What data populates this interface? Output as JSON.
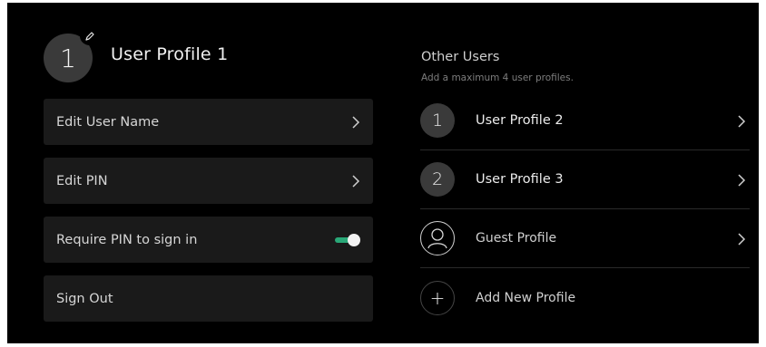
{
  "current_profile": {
    "avatar_number": "1",
    "name": "User Profile 1",
    "edit_icon": "pencil-icon"
  },
  "settings": [
    {
      "label": "Edit User Name",
      "control": "chevron"
    },
    {
      "label": "Edit PIN",
      "control": "chevron"
    },
    {
      "label": "Require PIN to sign in",
      "control": "toggle",
      "toggle_on": true
    },
    {
      "label": "Sign Out",
      "control": "none"
    }
  ],
  "other_users": {
    "title": "Other Users",
    "subtitle": "Add a maximum 4 user profiles.",
    "profiles": [
      {
        "avatar": "1",
        "name": "User Profile 2"
      },
      {
        "avatar": "2",
        "name": "User Profile 3"
      },
      {
        "avatar_icon": "person-icon",
        "name": "Guest Profile"
      },
      {
        "avatar": "+",
        "name": "Add New Profile"
      }
    ]
  },
  "colors": {
    "background": "#000000",
    "row_background": "#1a1a1a",
    "avatar_fill": "#3a3a3a",
    "toggle_accent": "#2aa878"
  }
}
